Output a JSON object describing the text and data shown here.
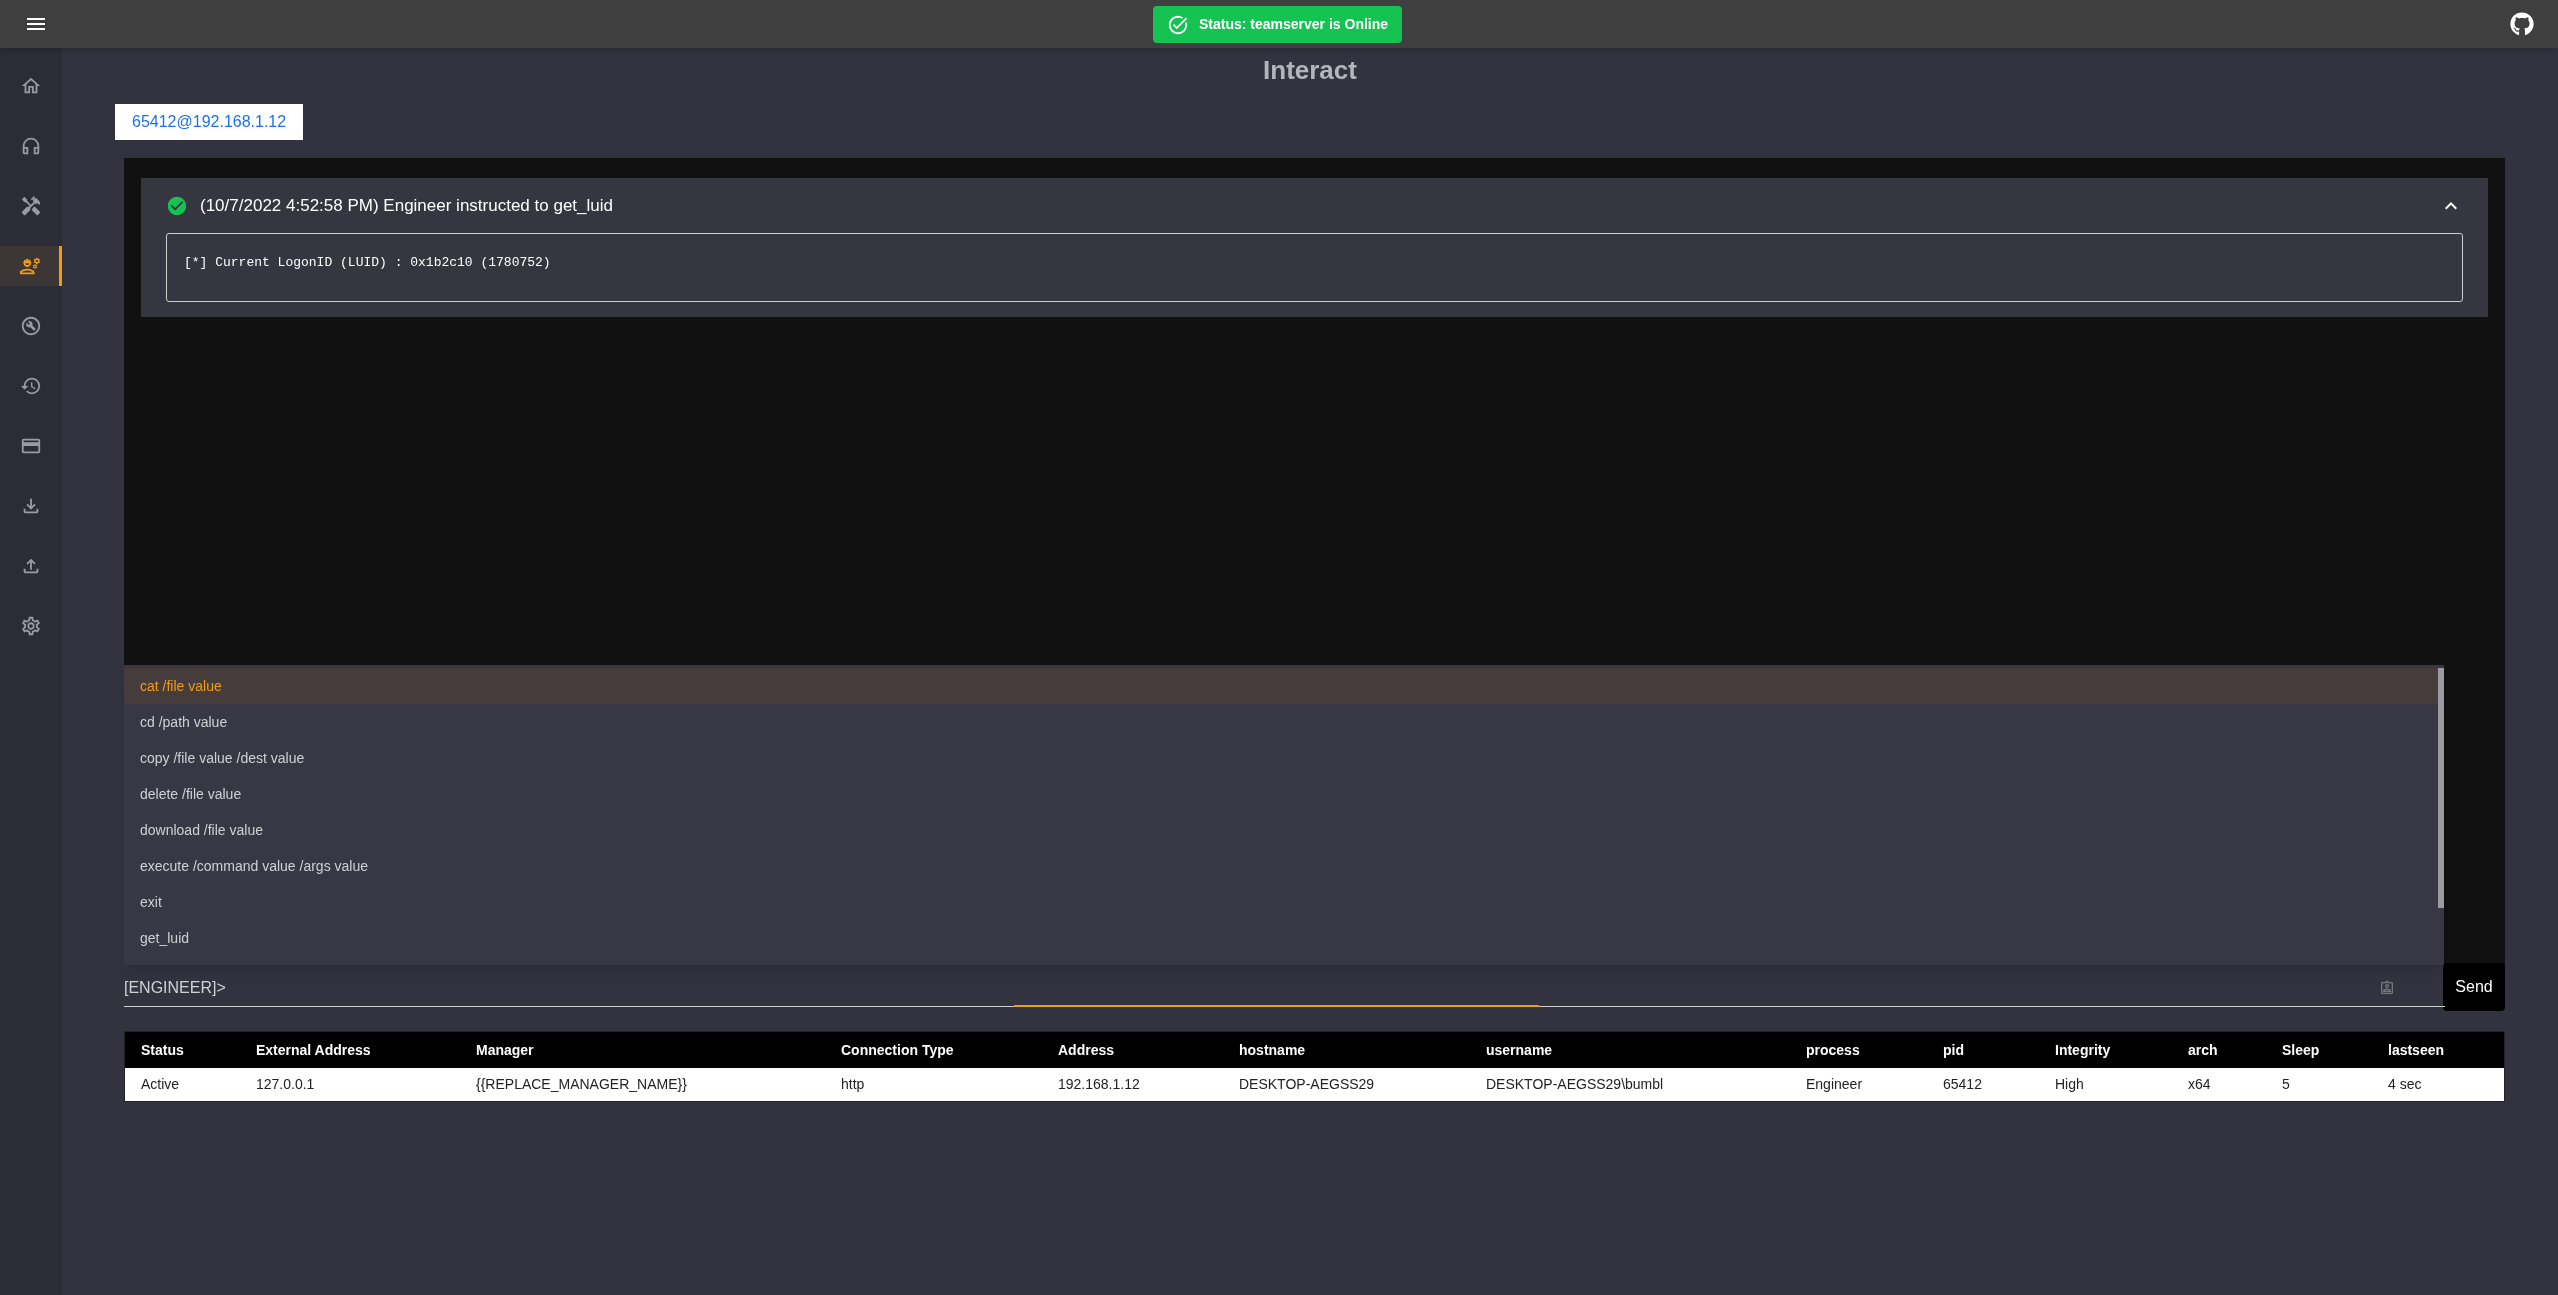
{
  "status": {
    "text": "Status: teamserver is Online"
  },
  "sidebar": {
    "items": [
      {
        "kind": "home",
        "selected": false
      },
      {
        "kind": "headphones",
        "selected": false
      },
      {
        "kind": "tools",
        "selected": false
      },
      {
        "kind": "engineer",
        "selected": true
      },
      {
        "kind": "build",
        "selected": false
      },
      {
        "kind": "history",
        "selected": false
      },
      {
        "kind": "card",
        "selected": false
      },
      {
        "kind": "download",
        "selected": false
      },
      {
        "kind": "upload",
        "selected": false
      },
      {
        "kind": "settings",
        "selected": false
      }
    ]
  },
  "page_title": "Interact",
  "tabs": [
    {
      "label": "65412@192.168.1.12",
      "selected": true
    }
  ],
  "terminal": {
    "entries": [
      {
        "title": "(10/7/2022 4:52:58 PM) Engineer instructed to get_luid",
        "expanded": true,
        "output": "[*] Current LogonID (LUID) : 0x1b2c10 (1780752)"
      }
    ]
  },
  "suggestions": [
    {
      "label": "cat /file value",
      "selected": true
    },
    {
      "label": "cd /path value",
      "selected": false
    },
    {
      "label": "copy /file value /dest value",
      "selected": false
    },
    {
      "label": "delete /file value",
      "selected": false
    },
    {
      "label": "download /file value",
      "selected": false
    },
    {
      "label": "execute /command value /args value",
      "selected": false
    },
    {
      "label": "exit",
      "selected": false
    },
    {
      "label": "get_luid",
      "selected": false
    }
  ],
  "command_input": {
    "value": "[ENGINEER]>"
  },
  "send_button": "Send",
  "table": {
    "columns": [
      "Status",
      "External Address",
      "Manager",
      "Connection Type",
      "Address",
      "hostname",
      "username",
      "process",
      "pid",
      "Integrity",
      "arch",
      "Sleep",
      "lastseen"
    ],
    "rows": [
      [
        "Active",
        "127.0.0.1",
        "{{REPLACE_MANAGER_NAME}}",
        "http",
        "192.168.1.12",
        "DESKTOP-AEGSS29",
        "DESKTOP-AEGSS29\\bumbl",
        "Engineer",
        "65412",
        "High",
        "x64",
        "5",
        "4 sec"
      ]
    ]
  }
}
